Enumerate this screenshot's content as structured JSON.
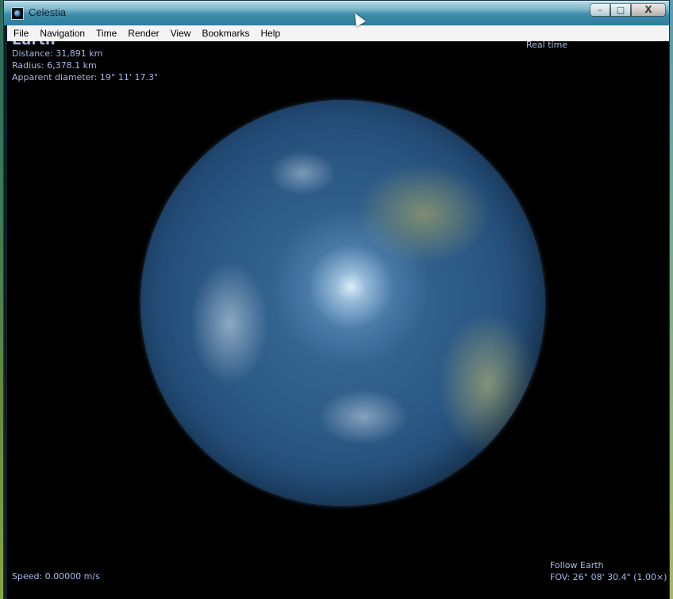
{
  "window": {
    "title": "Celestia",
    "controls": {
      "minimize": "–",
      "maximize": "□",
      "close": "X"
    }
  },
  "menu": [
    "File",
    "Navigation",
    "Time",
    "Render",
    "View",
    "Bookmarks",
    "Help"
  ],
  "hud": {
    "object_name": "Earth",
    "distance": "Distance: 31,891 km",
    "radius": "Radius: 6,378.1 km",
    "apparent_diameter": "Apparent diameter: 19° 11' 17.3\"",
    "time_mode": "Real time",
    "speed": "Speed: 0.00000 m/s",
    "follow": "Follow Earth",
    "fov": "FOV: 26° 08' 30.4\" (1.00×)"
  }
}
